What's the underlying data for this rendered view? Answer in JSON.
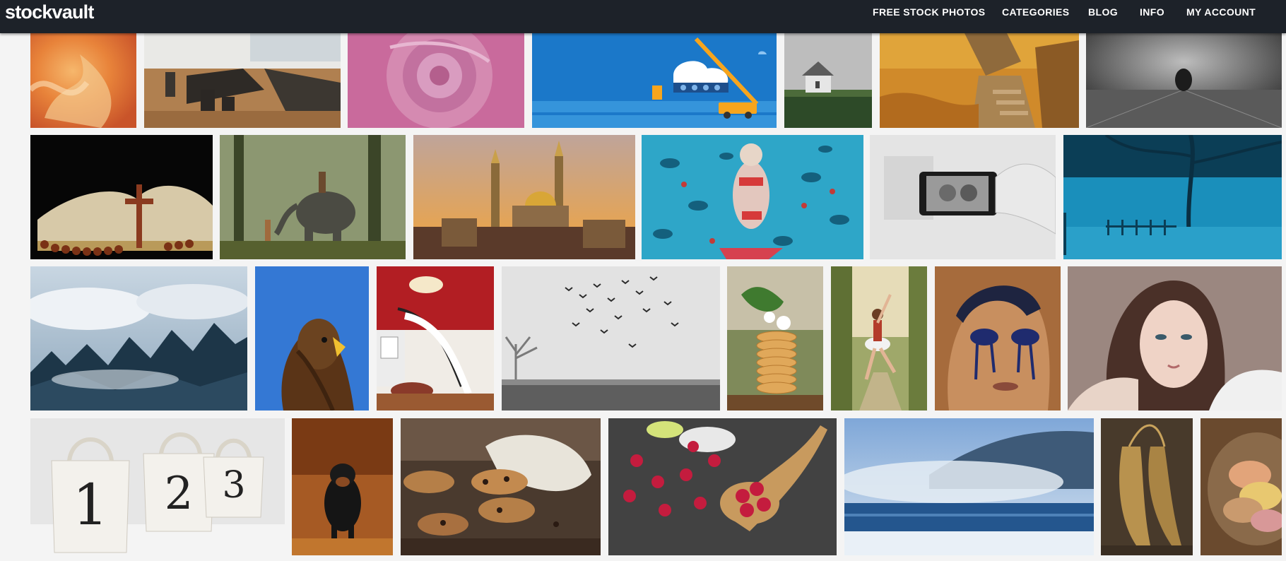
{
  "site": {
    "logo_text": "stockvault",
    "nav": [
      {
        "label": "FREE STOCK PHOTOS"
      },
      {
        "label": "CATEGORIES"
      },
      {
        "label": "BLOG"
      },
      {
        "label": "INFO"
      },
      {
        "label": "MY ACCOUNT"
      }
    ]
  },
  "gallery": {
    "rows": [
      [
        "fire-abstract",
        "conference-room",
        "pink-rose",
        "cloud-crane-illustration",
        "lonely-house",
        "autumn-ruins",
        "man-in-dark-room"
      ],
      [
        "bible-rosary",
        "boy-and-elephant",
        "mosque-sunset",
        "woman-on-floral-bed",
        "phone-selfie",
        "blue-foggy-tree"
      ],
      [
        "foggy-forest",
        "eagle",
        "red-staircase",
        "birds-in-fog",
        "cookie-stack",
        "dancer-in-field",
        "woman-blue-makeup",
        "woman-portrait"
      ],
      [
        "numbered-bags",
        "rottweiler",
        "chocolate-cookies",
        "raspberries-spoon",
        "snowy-lake",
        "ballet-shoes",
        "macarons"
      ]
    ],
    "thumb_numbers": [
      "1",
      "2",
      "3"
    ],
    "colors": {
      "nav_bg": "#1d2229",
      "page_bg": "#f4f4f4"
    }
  }
}
